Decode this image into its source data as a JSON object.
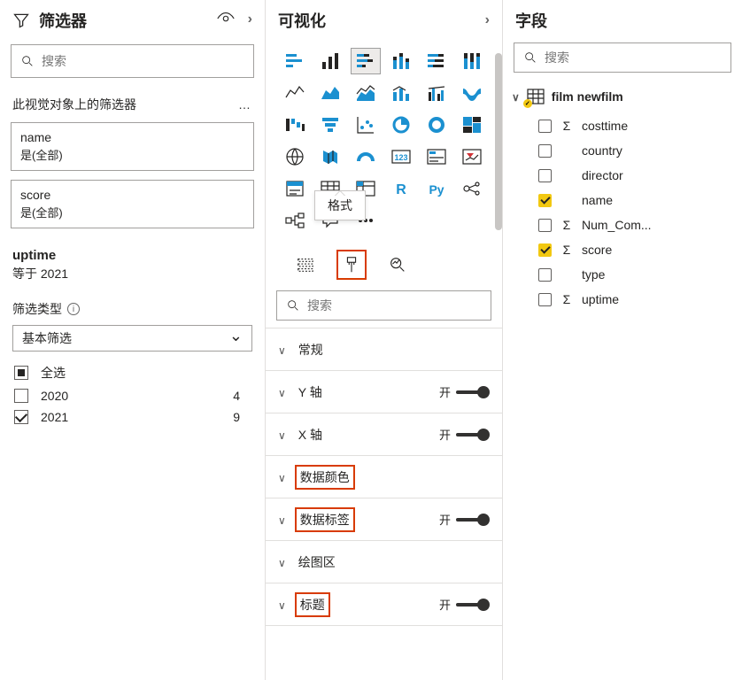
{
  "filters": {
    "title": "筛选器",
    "search_placeholder": "搜索",
    "section_label": "此视觉对象上的筛选器",
    "cards": [
      {
        "name": "name",
        "value": "是(全部)"
      },
      {
        "name": "score",
        "value": "是(全部)"
      }
    ],
    "active": {
      "name": "uptime",
      "value": "等于 2021"
    },
    "filter_type_label": "筛选类型",
    "filter_type_value": "基本筛选",
    "options": [
      {
        "label": "全选",
        "count": "",
        "state": "partial"
      },
      {
        "label": "2020",
        "count": "4",
        "state": "unchecked"
      },
      {
        "label": "2021",
        "count": "9",
        "state": "checked"
      }
    ]
  },
  "viz": {
    "title": "可视化",
    "tooltip": "格式",
    "search_placeholder": "搜索",
    "toggle_on": "开",
    "r_label": "R",
    "py_label": "Py",
    "pivot_label": "123",
    "sections": [
      {
        "label": "常规",
        "toggle": false,
        "red": false
      },
      {
        "label": "Y 轴",
        "toggle": true,
        "red": false
      },
      {
        "label": "X 轴",
        "toggle": true,
        "red": false
      },
      {
        "label": "数据颜色",
        "toggle": false,
        "red": true
      },
      {
        "label": "数据标签",
        "toggle": true,
        "red": true
      },
      {
        "label": "绘图区",
        "toggle": false,
        "red": false
      },
      {
        "label": "标题",
        "toggle": true,
        "red": true
      }
    ]
  },
  "fields": {
    "title": "字段",
    "search_placeholder": "搜索",
    "table": "film newfilm",
    "items": [
      {
        "name": "costtime",
        "checked": false,
        "sigma": true
      },
      {
        "name": "country",
        "checked": false,
        "sigma": false
      },
      {
        "name": "director",
        "checked": false,
        "sigma": false
      },
      {
        "name": "name",
        "checked": true,
        "sigma": false
      },
      {
        "name": "Num_Com...",
        "checked": false,
        "sigma": true
      },
      {
        "name": "score",
        "checked": true,
        "sigma": true
      },
      {
        "name": "type",
        "checked": false,
        "sigma": false
      },
      {
        "name": "uptime",
        "checked": false,
        "sigma": true
      }
    ]
  }
}
